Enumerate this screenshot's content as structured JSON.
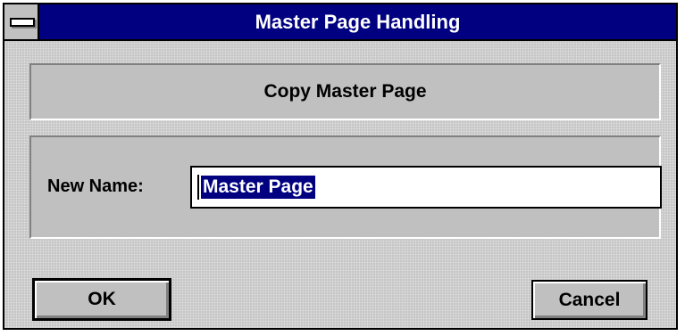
{
  "window": {
    "title": "Master Page Handling"
  },
  "header": {
    "label": "Copy Master Page"
  },
  "form": {
    "name_label": "New Name:",
    "name_value": "Master Page"
  },
  "buttons": {
    "ok_label": "OK",
    "cancel_label": "Cancel"
  },
  "colors": {
    "titlebar": "#000080",
    "selection": "#000080",
    "face": "#c0c0c0"
  }
}
